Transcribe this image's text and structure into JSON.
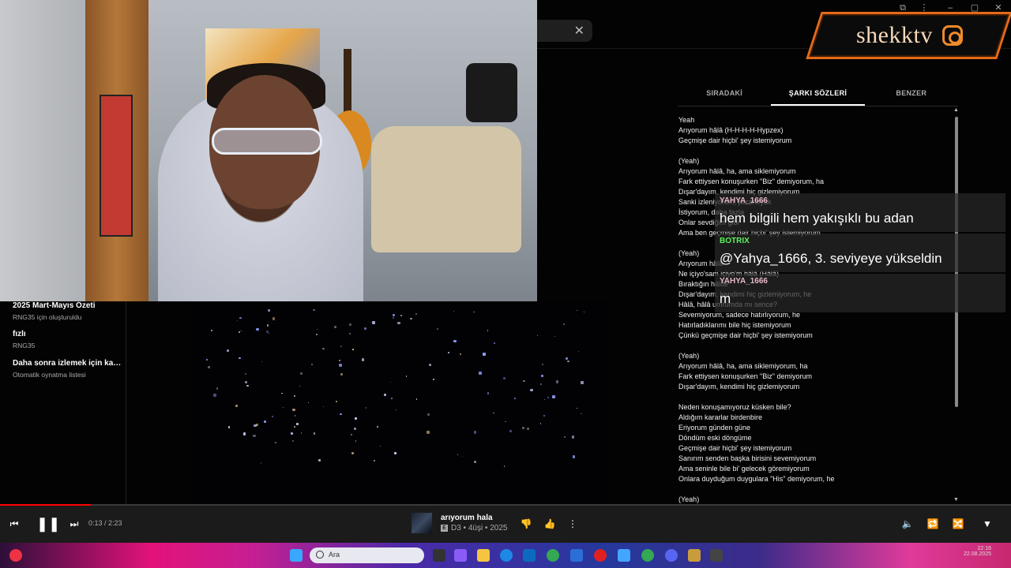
{
  "overlay": {
    "brand": "shekktv",
    "brand_icon": "instagram-icon",
    "accent": "#e56a19"
  },
  "tabs": [
    {
      "label": "SIRADAKİ"
    },
    {
      "label": "ŞARKI SÖZLERİ"
    },
    {
      "label": "BENZER"
    }
  ],
  "lyrics": [
    "Yeah",
    "Arıyorum hâlâ (H-H-H-H-Hypzex)",
    "Geçmişe dair hiçbi' şey istemiyorum",
    "",
    "(Yeah)",
    "Arıyorum hâlâ, ha, ama siklemiyorum",
    "Fark ettiysen konuşurken \"Biz\" demiyorum, ha",
    "Dışar'dayım, kendimi hiç gizlemiyorum",
    "Sanki izleniyorum, paranoyak",
    "İstiyorum, daha fazla",
    "Onlar sevdiğim gibi",
    "Ama ben geçmişe dair hiçbi' şey istemiyorum",
    "",
    "(Yeah)",
    "Arıyorum hâlâ",
    "Ne içiyo'sam içiyo'm hâlâ (Hâlâ)",
    "Bıraktığın hâlde",
    "Dışar'dayım, kendimi hiç gizlemiyorum, he",
    "Hâlâ, hâlâ umrumda mı sence?",
    "Sevemiyorum, sadece hatırlıyorum, he",
    "Hatırladıklarımı bile hiç istemiyorum",
    "Çünkü geçmişe dair hiçbi' şey istemiyorum",
    "",
    "(Yeah)",
    "Arıyorum hâlâ, ha, ama siklemiyorum, ha",
    "Fark ettiysen konuşurken \"Biz\" demiyorum",
    "Dışar'dayım, kendimi hiç gizlemiyorum",
    "",
    "Neden konuşamıyoruz küsken bile?",
    "Aldığım kararlar birdenbire",
    "Eriyorum günden güne",
    "Döndüm eski döngüme",
    "Geçmişe dair hiçbi' şey istemiyorum",
    "Sanırım senden başka birisini sevemiyorum",
    "Ama seninle bile bi' gelecek göremiyorum",
    "Onlara duyduğum duygulara \"His\" demiyorum, he",
    "",
    "(Yeah)"
  ],
  "chat": [
    {
      "user": "YAHYA_1666",
      "message": "hem bilgili hem yakışıklı bu adan",
      "color": "#e6b8c8"
    },
    {
      "user": "BOTRIX",
      "message": "@Yahya_1666, 3. seviyeye yükseldin",
      "color": "#5cf55c"
    },
    {
      "user": "YAHYA_1666",
      "message": "m",
      "color": "#e6b8c8"
    }
  ],
  "queue": [
    {
      "title": "2025 Mart-Mayıs Özeti",
      "subtitle": "RNG35 için oluşturuldu"
    },
    {
      "title": "fızlı",
      "subtitle": "RNG35"
    },
    {
      "title": "Daha sonra izlemek için kaydedilenler",
      "subtitle": "Otomatik oynatma listesi"
    }
  ],
  "player": {
    "time": "0:13 / 2:23",
    "progress_fraction": 0.09,
    "title": "arıyorum hala",
    "explicit_badge": "E",
    "subtitle": "D3 • 4üşi • 2025",
    "progress_color": "#ff0000"
  },
  "taskbar": {
    "search_placeholder": "Ara",
    "clock_time": "22:16",
    "clock_date": "22.08.2025"
  }
}
